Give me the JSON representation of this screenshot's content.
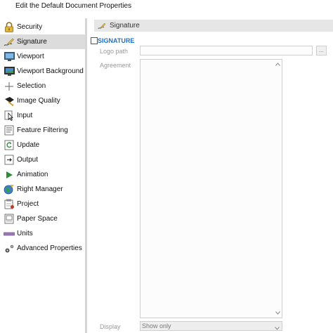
{
  "window": {
    "title": "Edit the Default Document Properties"
  },
  "sidebar": {
    "items": [
      {
        "label": "Security",
        "icon": "lock-icon"
      },
      {
        "label": "Signature",
        "icon": "signature-pen-icon",
        "selected": true
      },
      {
        "label": "Viewport",
        "icon": "viewport-monitor-icon"
      },
      {
        "label": "Viewport Background",
        "icon": "viewport-background-icon"
      },
      {
        "label": "Selection",
        "icon": "crosshair-icon"
      },
      {
        "label": "Image Quality",
        "icon": "image-quality-icon"
      },
      {
        "label": "Input",
        "icon": "input-cursor-icon"
      },
      {
        "label": "Feature Filtering",
        "icon": "feature-filtering-icon"
      },
      {
        "label": "Update",
        "icon": "update-icon"
      },
      {
        "label": "Output",
        "icon": "output-icon"
      },
      {
        "label": "Animation",
        "icon": "play-icon"
      },
      {
        "label": "Right Manager",
        "icon": "rights-globe-icon"
      },
      {
        "label": "Project",
        "icon": "project-icon"
      },
      {
        "label": "Paper Space",
        "icon": "paper-space-icon"
      },
      {
        "label": "Units",
        "icon": "ruler-icon"
      },
      {
        "label": "Advanced Properties",
        "icon": "gears-icon"
      }
    ]
  },
  "main": {
    "section_title": "Signature",
    "signature_checkbox_label": "SIGNATURE",
    "signature_checked": false,
    "logo_path_label": "Logo path",
    "logo_path_value": "",
    "browse_label": "...",
    "agreement_label": "Agreement",
    "agreement_value": "",
    "display_label": "Display",
    "display_value": "Show only"
  },
  "colors": {
    "selected_bg": "#dcdcdc",
    "header_bg": "#e6e6e6",
    "accent_blue": "#1f6fc5",
    "muted_label": "#9a9a9a"
  }
}
